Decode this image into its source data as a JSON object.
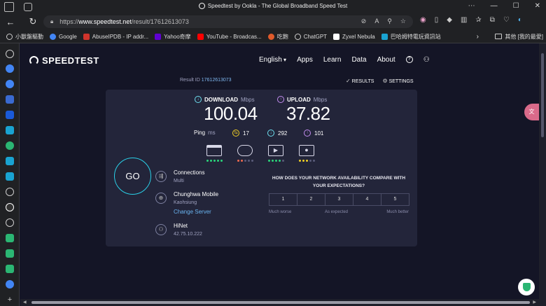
{
  "browser": {
    "window_title": "Speedtest by Ookla - The Global Broadband Speed Test",
    "url_scheme": "https://",
    "url_host": "www.speedtest.net",
    "url_path": "/result/17612613073",
    "bookmarks": [
      {
        "label": "小獸盤驅動",
        "color": "#e8e8e8"
      },
      {
        "label": "Google",
        "color": "#4285f4"
      },
      {
        "label": "AbuseIPDB - IP addr...",
        "color": "#d0342c"
      },
      {
        "label": "Yahoo奇摩",
        "color": "#6001d2"
      },
      {
        "label": "YouTube - Broadcas...",
        "color": "#ff0000"
      },
      {
        "label": "吃飽",
        "color": "#e05a2a"
      },
      {
        "label": "ChatGPT",
        "color": "#cfcfcf"
      },
      {
        "label": "Zyxel Nebula",
        "color": "#ffffff"
      },
      {
        "label": "巴哈姆特電玩資訊站",
        "color": "#19a3d1"
      }
    ],
    "bookmarks_more": "›",
    "other_bookmarks": "其他 [我的最愛]"
  },
  "site": {
    "logo": "SPEEDTEST",
    "nav": {
      "language": "English",
      "apps": "Apps",
      "learn": "Learn",
      "data": "Data",
      "about": "About",
      "help": "?"
    },
    "result_id_label": "Result ID",
    "result_id": "17612613073",
    "results_link": "RESULTS",
    "settings_link": "SETTINGS"
  },
  "result": {
    "download_label": "DOWNLOAD",
    "download_unit": "Mbps",
    "download_value": "100.04",
    "upload_label": "UPLOAD",
    "upload_unit": "Mbps",
    "upload_value": "37.82",
    "ping_label": "Ping",
    "ping_unit": "ms",
    "ping_idle": "17",
    "ping_download": "292",
    "ping_upload": "101",
    "go_label": "GO"
  },
  "connection": {
    "connections_label": "Connections",
    "connections_mode": "Multi",
    "server_name": "Chunghwa Mobile",
    "server_location": "Kaohsiung",
    "change_server": "Change Server",
    "isp": "HiNet",
    "ip": "42.75.10.222"
  },
  "survey": {
    "question": "HOW DOES YOUR NETWORK AVAILABILITY COMPARE WITH YOUR EXPECTATIONS?",
    "options": [
      "1",
      "2",
      "3",
      "4",
      "5"
    ],
    "label_low": "Much worse",
    "label_mid": "As expected",
    "label_high": "Much better"
  },
  "colors": {
    "download": "#6ee0f0",
    "upload": "#c38df0",
    "ping": "#f2d024",
    "go_ring": "#2ad0e8",
    "link": "#6ab4f0"
  },
  "use_cases": [
    {
      "name": "web-browsing-icon",
      "dots": [
        "#2bd67b",
        "#2bd67b",
        "#2bd67b",
        "#2bd67b",
        "#2bd67b"
      ]
    },
    {
      "name": "gaming-icon",
      "dots": [
        "#f06a50",
        "#f06a50",
        "#5a5c7a",
        "#5a5c7a",
        "#5a5c7a"
      ]
    },
    {
      "name": "video-streaming-icon",
      "dots": [
        "#2bd67b",
        "#2bd67b",
        "#2bd67b",
        "#2bd67b",
        "#5a5c7a"
      ]
    },
    {
      "name": "video-chat-icon",
      "dots": [
        "#f2d024",
        "#f2d024",
        "#f2d024",
        "#5a5c7a",
        "#5a5c7a"
      ]
    }
  ]
}
